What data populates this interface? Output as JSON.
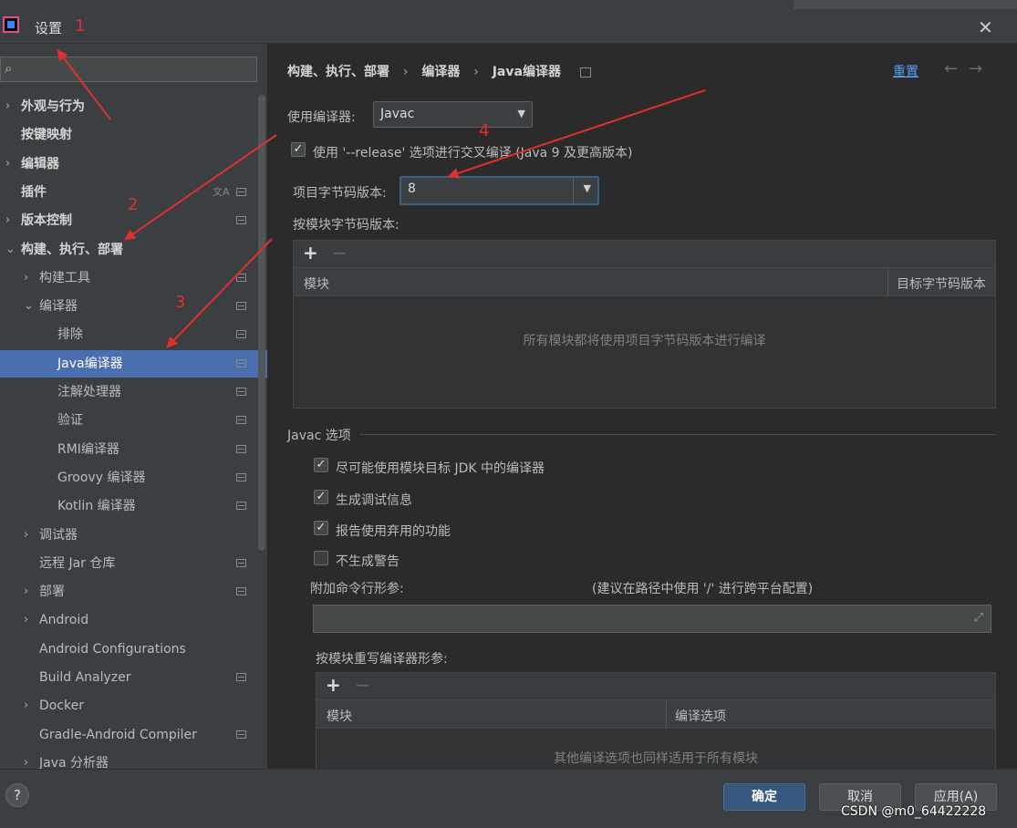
{
  "window": {
    "title": "设置",
    "close_icon": "close-icon"
  },
  "sidebar": {
    "search_placeholder": "",
    "items": [
      {
        "label": "外观与行为",
        "chevron": "›",
        "bold": true
      },
      {
        "label": "按键映射",
        "chevron": "",
        "bold": true
      },
      {
        "label": "编辑器",
        "chevron": "›",
        "bold": true
      },
      {
        "label": "插件",
        "chevron": "",
        "bold": true
      },
      {
        "label": "版本控制",
        "chevron": "›",
        "bold": true
      },
      {
        "label": "构建、执行、部署",
        "chevron": "⌄",
        "bold": true
      },
      {
        "label": "构建工具",
        "chevron": "›"
      },
      {
        "label": "编译器",
        "chevron": "⌄"
      },
      {
        "label": "排除"
      },
      {
        "label": "Java编译器",
        "selected": true
      },
      {
        "label": "注解处理器"
      },
      {
        "label": "验证"
      },
      {
        "label": "RMI编译器"
      },
      {
        "label": "Groovy 编译器"
      },
      {
        "label": "Kotlin 编译器"
      },
      {
        "label": "调试器",
        "chevron": "›"
      },
      {
        "label": "远程 Jar 仓库"
      },
      {
        "label": "部署",
        "chevron": "›"
      },
      {
        "label": "Android",
        "chevron": "›"
      },
      {
        "label": "Android Configurations"
      },
      {
        "label": "Build Analyzer"
      },
      {
        "label": "Docker",
        "chevron": "›"
      },
      {
        "label": "Gradle-Android Compiler"
      },
      {
        "label": "Java 分析器",
        "chevron": "›"
      }
    ]
  },
  "main": {
    "breadcrumb": [
      "构建、执行、部署",
      "编译器",
      "Java编译器"
    ],
    "breadcrumb_sep": "›",
    "reset_label": "重置",
    "nav_back": "←",
    "nav_forward": "→",
    "compiler_label": "使用编译器:",
    "compiler_value": "Javac",
    "release_checkbox_label": "使用 '--release' 选项进行交叉编译 (Java 9 及更高版本)",
    "release_checked": true,
    "bytecode_label": "项目字节码版本:",
    "bytecode_value": "8",
    "per_module_label": "按模块字节码版本:",
    "module_table": {
      "columns": [
        "模块",
        "目标字节码版本"
      ],
      "empty_text": "所有模块都将使用项目字节码版本进行编译"
    },
    "javac_section": "Javac 选项",
    "javac_options": [
      {
        "label": "尽可能使用模块目标 JDK 中的编译器",
        "checked": true
      },
      {
        "label": "生成调试信息",
        "checked": true
      },
      {
        "label": "报告使用弃用的功能",
        "checked": true
      },
      {
        "label": "不生成警告",
        "checked": false
      }
    ],
    "extra_args_label": "附加命令行形参:",
    "extra_args_hint": "(建议在路径中使用 '/' 进行跨平台配置)",
    "extra_args_value": "",
    "override_label": "按模块重写编译器形参:",
    "override_table": {
      "columns": [
        "模块",
        "编译选项"
      ],
      "empty_text": "其他编译选项也同样适用于所有模块"
    }
  },
  "footer": {
    "help": "?",
    "ok": "确定",
    "cancel": "取消",
    "apply": "应用(A)",
    "watermark": "CSDN @m0_64422228"
  },
  "annotations": [
    "1",
    "2",
    "3",
    "4"
  ],
  "colors": {
    "accent": "#4b6eaf",
    "link": "#589df6",
    "annotation": "#e0302d",
    "background": "#2b2b2b"
  }
}
